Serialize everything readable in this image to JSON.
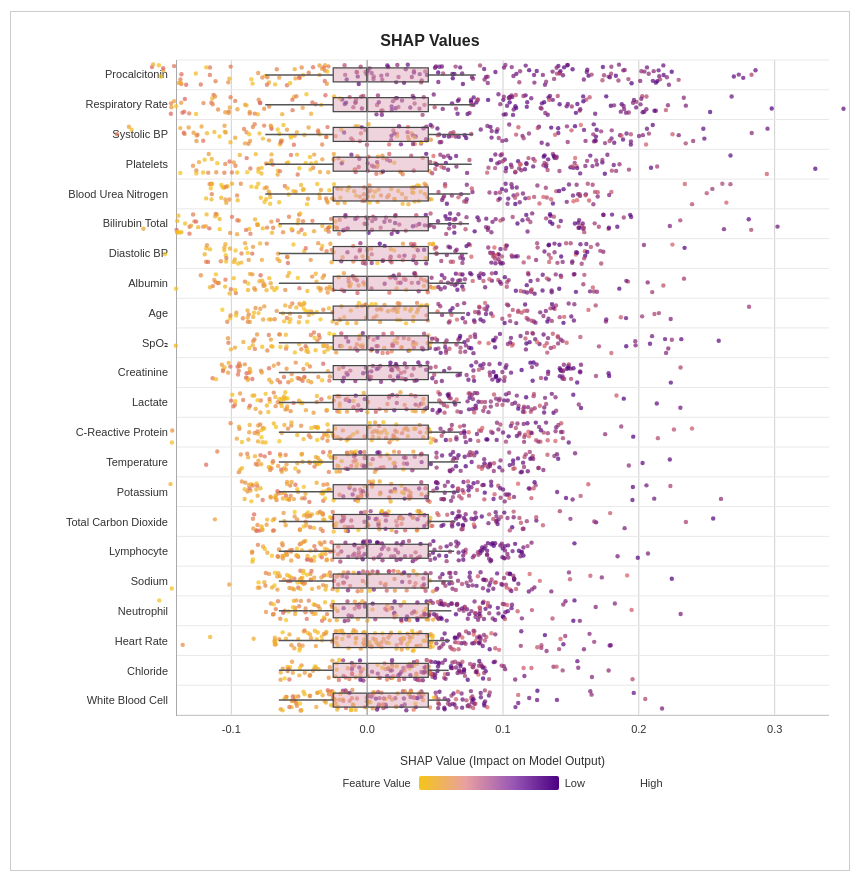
{
  "title": "SHAP Values",
  "xaxis_title": "SHAP Value (Impact on Model Output)",
  "legend": {
    "feature_value_label": "Feature Value",
    "low_label": "Low",
    "high_label": "High"
  },
  "x_ticks": [
    {
      "label": "-0.1",
      "pct": 18
    },
    {
      "label": "0.0",
      "pct": 36
    },
    {
      "label": "0.1",
      "pct": 54
    },
    {
      "label": "0.2",
      "pct": 72
    },
    {
      "label": "0.3",
      "pct": 90
    }
  ],
  "features": [
    {
      "name": "Procalcitonin",
      "q1": 37,
      "q3": 52,
      "med": 44,
      "wl": 18,
      "wr": 80,
      "spread": 3.2,
      "color_skew": "purple"
    },
    {
      "name": "Respiratory Rate",
      "q1": 38,
      "q3": 51,
      "med": 44,
      "wl": 20,
      "wr": 78,
      "spread": 3.0,
      "color_skew": "purple"
    },
    {
      "name": "Systolic BP",
      "q1": 36,
      "q3": 50,
      "med": 43,
      "wl": 20,
      "wr": 74,
      "spread": 2.8,
      "color_skew": "mixed"
    },
    {
      "name": "Platelets",
      "q1": 37,
      "q3": 50,
      "med": 43,
      "wl": 20,
      "wr": 68,
      "spread": 2.6,
      "color_skew": "mixed"
    },
    {
      "name": "Blood Urea Nitrogen",
      "q1": 38,
      "q3": 50,
      "med": 44,
      "wl": 22,
      "wr": 66,
      "spread": 2.5,
      "color_skew": "orange"
    },
    {
      "name": "Bilirubin Total",
      "q1": 37,
      "q3": 50,
      "med": 43,
      "wl": 20,
      "wr": 75,
      "spread": 2.8,
      "color_skew": "purple"
    },
    {
      "name": "Diastolic BP",
      "q1": 37,
      "q3": 50,
      "med": 43,
      "wl": 22,
      "wr": 68,
      "spread": 2.4,
      "color_skew": "mixed"
    },
    {
      "name": "Albumin",
      "q1": 37,
      "q3": 50,
      "med": 43,
      "wl": 22,
      "wr": 60,
      "spread": 2.3,
      "color_skew": "mixed"
    },
    {
      "name": "Age",
      "q1": 38,
      "q3": 50,
      "med": 43,
      "wl": 24,
      "wr": 62,
      "spread": 2.2,
      "color_skew": "orange"
    },
    {
      "name": "SpO₂",
      "q1": 38,
      "q3": 50,
      "med": 43,
      "wl": 24,
      "wr": 65,
      "spread": 2.1,
      "color_skew": "mixed"
    },
    {
      "name": "Creatinine",
      "q1": 37,
      "q3": 49,
      "med": 43,
      "wl": 20,
      "wr": 62,
      "spread": 2.3,
      "color_skew": "purple"
    },
    {
      "name": "Lactate",
      "q1": 37,
      "q3": 49,
      "med": 43,
      "wl": 22,
      "wr": 60,
      "spread": 2.0,
      "color_skew": "mixed"
    },
    {
      "name": "C-Reactive Protein",
      "q1": 37,
      "q3": 49,
      "med": 43,
      "wl": 24,
      "wr": 60,
      "spread": 2.0,
      "color_skew": "orange"
    },
    {
      "name": "Temperature",
      "q1": 37,
      "q3": 49,
      "med": 43,
      "wl": 24,
      "wr": 60,
      "spread": 1.9,
      "color_skew": "mixed"
    },
    {
      "name": "Potassium",
      "q1": 38,
      "q3": 49,
      "med": 43,
      "wl": 25,
      "wr": 58,
      "spread": 1.8,
      "color_skew": "mixed"
    },
    {
      "name": "Total Carbon Dioxide",
      "q1": 38,
      "q3": 49,
      "med": 43,
      "wl": 26,
      "wr": 57,
      "spread": 1.7,
      "color_skew": "mixed"
    },
    {
      "name": "Lymphocyte",
      "q1": 37,
      "q3": 48,
      "med": 43,
      "wl": 25,
      "wr": 57,
      "spread": 1.7,
      "color_skew": "purple"
    },
    {
      "name": "Sodium",
      "q1": 37,
      "q3": 48,
      "med": 43,
      "wl": 26,
      "wr": 56,
      "spread": 1.6,
      "color_skew": "mixed"
    },
    {
      "name": "Neutrophil",
      "q1": 38,
      "q3": 48,
      "med": 43,
      "wl": 27,
      "wr": 55,
      "spread": 1.5,
      "color_skew": "mixed"
    },
    {
      "name": "Heart Rate",
      "q1": 38,
      "q3": 48,
      "med": 43,
      "wl": 27,
      "wr": 55,
      "spread": 1.4,
      "color_skew": "orange"
    },
    {
      "name": "Chloride",
      "q1": 38,
      "q3": 48,
      "med": 43,
      "wl": 28,
      "wr": 54,
      "spread": 1.3,
      "color_skew": "mixed"
    },
    {
      "name": "White Blood Cell",
      "q1": 37,
      "q3": 48,
      "med": 43,
      "wl": 28,
      "wr": 54,
      "spread": 1.3,
      "color_skew": "mixed"
    }
  ]
}
